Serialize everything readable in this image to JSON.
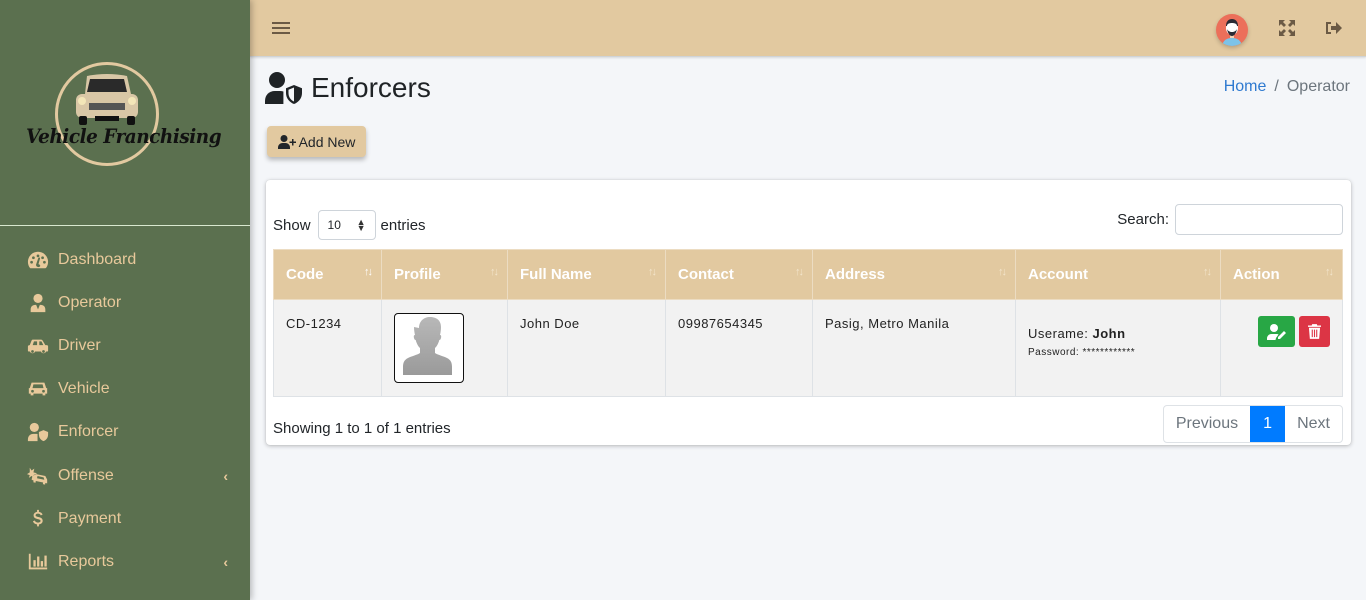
{
  "brand": {
    "name": "Vehicle Franchising"
  },
  "sidebar": {
    "items": [
      {
        "label": "Dashboard",
        "icon": "tachometer-icon",
        "has_submenu": false
      },
      {
        "label": "Operator",
        "icon": "user-tie-icon",
        "has_submenu": false
      },
      {
        "label": "Driver",
        "icon": "car-side-icon",
        "has_submenu": false
      },
      {
        "label": "Vehicle",
        "icon": "car-icon",
        "has_submenu": false
      },
      {
        "label": "Enforcer",
        "icon": "user-shield-icon",
        "has_submenu": false
      },
      {
        "label": "Offense",
        "icon": "car-crash-icon",
        "has_submenu": true
      },
      {
        "label": "Payment",
        "icon": "dollar-sign-icon",
        "has_submenu": false
      },
      {
        "label": "Reports",
        "icon": "chart-bar-icon",
        "has_submenu": true
      }
    ],
    "chevron": "‹"
  },
  "topbar": {
    "menu_icon": "bars-icon",
    "fullscreen_icon": "expand-arrows-icon",
    "logout_icon": "sign-out-icon"
  },
  "page": {
    "title": "Enforcers",
    "breadcrumb": {
      "home": "Home",
      "separator": "/",
      "current": "Operator"
    },
    "add_button": "Add New"
  },
  "table_controls": {
    "show_label": "Show",
    "entries_label": "entries",
    "page_length": "10",
    "search_label": "Search:",
    "search_value": ""
  },
  "table": {
    "columns": [
      "Code",
      "Profile",
      "Full Name",
      "Contact",
      "Address",
      "Account",
      "Action"
    ],
    "rows": [
      {
        "code": "CD-1234",
        "profile": "default-avatar",
        "full_name": "John Doe",
        "contact": "09987654345",
        "address": "Pasig, Metro Manila",
        "username_label": "Userame:",
        "username": "John",
        "password_label": "Password:",
        "password": "************"
      }
    ]
  },
  "footer": {
    "info": "Showing 1 to 1 of 1 entries",
    "previous": "Previous",
    "current_page": "1",
    "next": "Next"
  },
  "colors": {
    "sidebar_bg": "#5b704f",
    "sidebar_text": "#e8c99b",
    "accent": "#e2c9a0",
    "primary": "#007bff",
    "success": "#28a745",
    "danger": "#dc3545"
  }
}
